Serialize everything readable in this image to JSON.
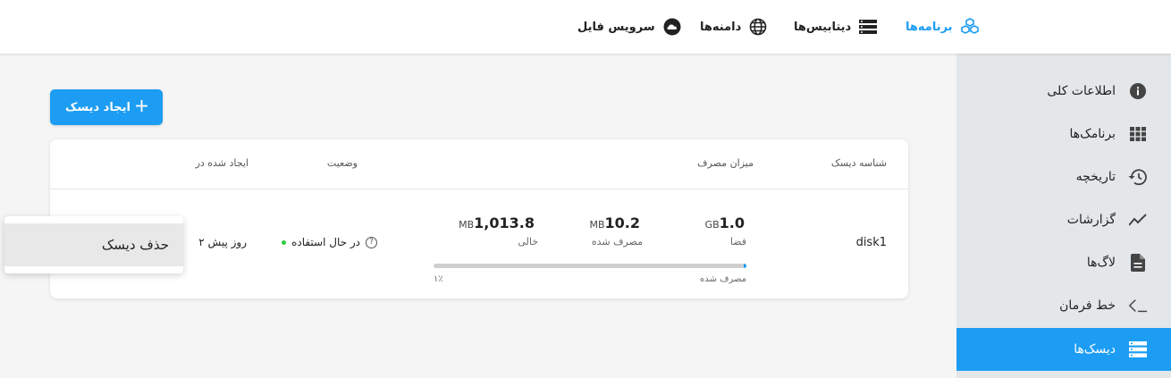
{
  "topnav": {
    "apps_label": "برنامه‌ها",
    "databases_label": "دیتابیس‌ها",
    "domains_label": "دامنه‌ها",
    "file_service_label": "سرویس فایل"
  },
  "sidebar": {
    "items": [
      {
        "label": "اطلاعات کلی",
        "icon": "info-icon"
      },
      {
        "label": "برنامک‌ها",
        "icon": "grid-icon"
      },
      {
        "label": "تاریخچه",
        "icon": "history-icon"
      },
      {
        "label": "گزارشات",
        "icon": "chart-line-icon"
      },
      {
        "label": "لاگ‌ها",
        "icon": "document-icon"
      },
      {
        "label": "خط فرمان",
        "icon": "terminal-icon"
      },
      {
        "label": "دیسک‌ها",
        "icon": "disk-stack-icon"
      }
    ],
    "active_index": 6
  },
  "create_button": {
    "label": "ایجاد دیسک"
  },
  "table": {
    "headers": {
      "disk_id": "شناسه دیسک",
      "usage": "میزان مصرف",
      "status": "وضعیت",
      "created_at": "ایجاد شده در"
    },
    "rows": [
      {
        "disk_id": "disk1",
        "space_value": "1.0",
        "space_unit": "GB",
        "space_label": "فضا",
        "used_value": "10.2",
        "used_unit": "MB",
        "used_label": "مصرف شده",
        "free_value": "1,013.8",
        "free_unit": "MB",
        "free_label": "خالی",
        "progress_label": "مصرف شده",
        "progress_percent_text": "۱٪",
        "progress_fraction": 0.01,
        "status": "در حال استفاده",
        "created_at": "۲ روز پیش"
      }
    ]
  },
  "popup": {
    "delete_label": "حذف دیسک"
  },
  "colors": {
    "accent": "#1c9df3",
    "status_ok": "#2ecc40"
  }
}
